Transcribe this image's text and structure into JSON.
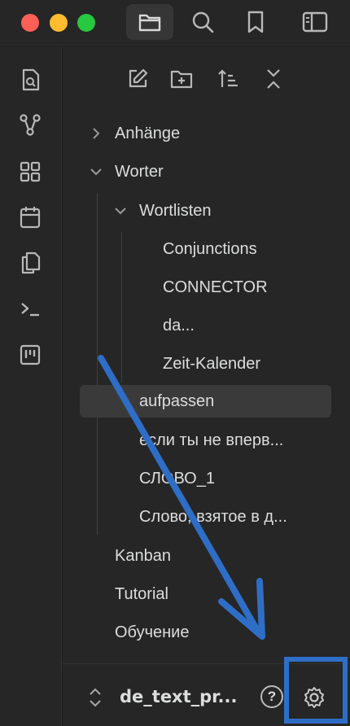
{
  "titlebar": {
    "buttons": [
      {
        "icon": "folder-icon",
        "active": true
      },
      {
        "icon": "search-icon"
      },
      {
        "icon": "bookmark-icon"
      },
      {
        "icon": "sidebar-toggle-icon"
      }
    ]
  },
  "ribbon": {
    "icons": [
      "quick-switcher-icon",
      "graph-icon",
      "canvas-icon",
      "calendar-icon",
      "templates-icon",
      "command-palette-icon",
      "kanban-icon"
    ]
  },
  "nav_actions": [
    "new-note-icon",
    "new-folder-icon",
    "sort-icon",
    "collapse-all-icon"
  ],
  "tree": {
    "anhaenge": "Anhänge",
    "worter": "Worter",
    "wortlisten": "Wortlisten",
    "conjunctions": "Conjunctions",
    "connector": "CONNECTOR",
    "da": "da...",
    "zeit_kalender": "Zeit-Kalender",
    "aufpassen": "aufpassen",
    "esli": "если ты не вперв...",
    "slovo1": "СЛОВО_1",
    "slovo_vzyatoe": "Слово, взятое в д...",
    "kanban": "Kanban",
    "tutorial": "Tutorial",
    "obuchenie": "Обучение"
  },
  "footer": {
    "vault_name": "de_text_pr...",
    "help": "?"
  },
  "colors": {
    "accent_annotation": "#2f6ec7",
    "selected_bg": "#3a3a3a"
  }
}
